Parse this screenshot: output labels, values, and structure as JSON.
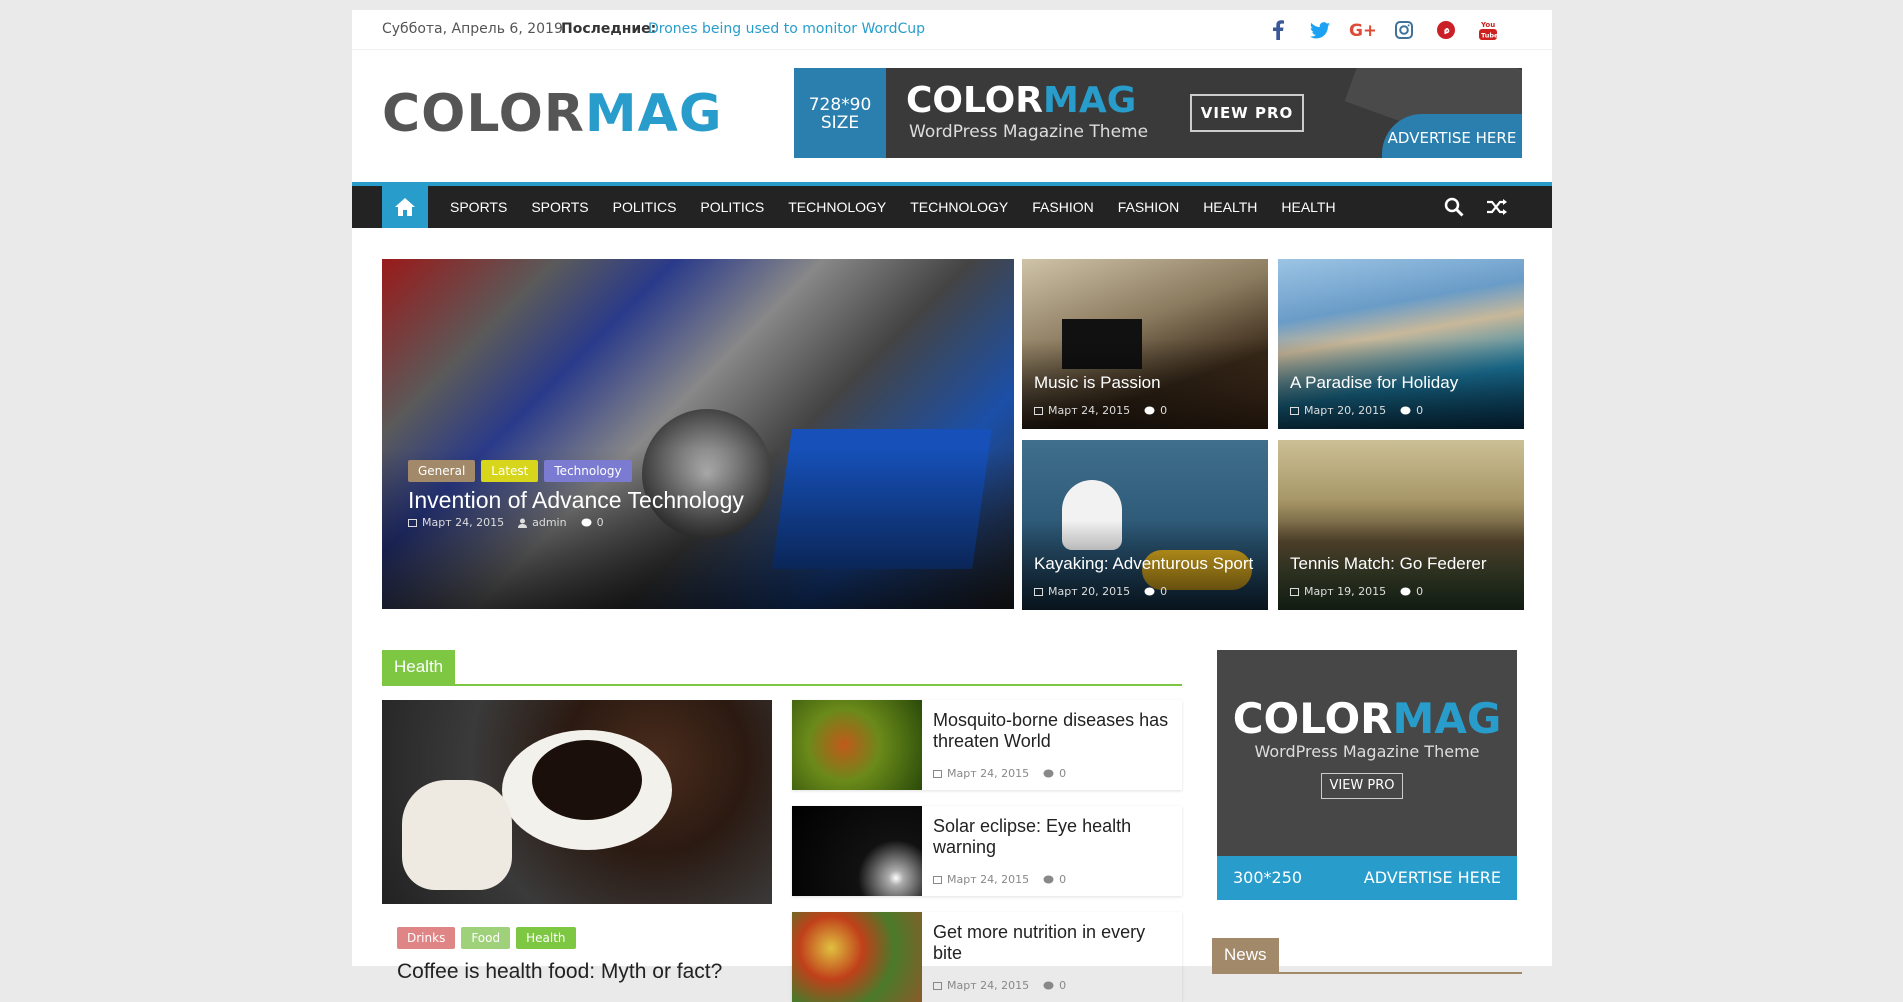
{
  "topbar": {
    "date": "Суббота, Апрель 6, 2019",
    "latest_label": "Последние:",
    "latest_link": "Drones being used to monitor WordCup"
  },
  "social_icons": [
    "facebook-icon",
    "twitter-icon",
    "google-plus-icon",
    "instagram-icon",
    "pinterest-icon",
    "youtube-icon"
  ],
  "colors": {
    "accent": "#289dcc",
    "nav_bg": "#232323",
    "health": "#7dc743",
    "news": "#a1896a"
  },
  "logo": {
    "part1": "COLOR",
    "part2": "MAG"
  },
  "banner": {
    "size": "728*90\nSIZE",
    "size_line1": "728*90",
    "size_line2": "SIZE",
    "logo1": "COLOR",
    "logo2": "MAG",
    "subtitle": "WordPress Magazine Theme",
    "button": "VIEW PRO",
    "advertise": "ADVERTISE HERE"
  },
  "nav": {
    "items": [
      "SPORTS",
      "SPORTS",
      "POLITICS",
      "POLITICS",
      "TECHNOLOGY",
      "TECHNOLOGY",
      "FASHION",
      "FASHION",
      "HEALTH",
      "HEALTH"
    ]
  },
  "featured": {
    "main": {
      "tags": [
        "General",
        "Latest",
        "Technology"
      ],
      "title": "Invention of Advance Technology",
      "date": "Март 24, 2015",
      "author": "admin",
      "comments": "0"
    },
    "thumbs": [
      {
        "title": "Music is Passion",
        "date": "Март 24, 2015",
        "comments": "0"
      },
      {
        "title": "A Paradise for Holiday",
        "date": "Март 20, 2015",
        "comments": "0"
      },
      {
        "title": "Kayaking: Adventurous Sport",
        "date": "Март 20, 2015",
        "comments": "0"
      },
      {
        "title": "Tennis Match: Go Federer",
        "date": "Март 19, 2015",
        "comments": "0"
      }
    ]
  },
  "health": {
    "heading": "Health",
    "main": {
      "tags": [
        "Drinks",
        "Food",
        "Health"
      ],
      "title": "Coffee is health food: Myth or fact?"
    },
    "items": [
      {
        "title": "Mosquito-borne diseases has threaten World",
        "date": "Март 24, 2015",
        "comments": "0"
      },
      {
        "title": "Solar eclipse: Eye health warning",
        "date": "Март 24, 2015",
        "comments": "0"
      },
      {
        "title": "Get more nutrition in every bite",
        "date": "Март 24, 2015",
        "comments": "0"
      }
    ]
  },
  "sidebar": {
    "ad": {
      "logo1": "COLOR",
      "logo2": "MAG",
      "subtitle": "WordPress Magazine Theme",
      "button": "VIEW PRO",
      "size": "300*250",
      "advertise": "ADVERTISE HERE"
    },
    "news_heading": "News"
  }
}
